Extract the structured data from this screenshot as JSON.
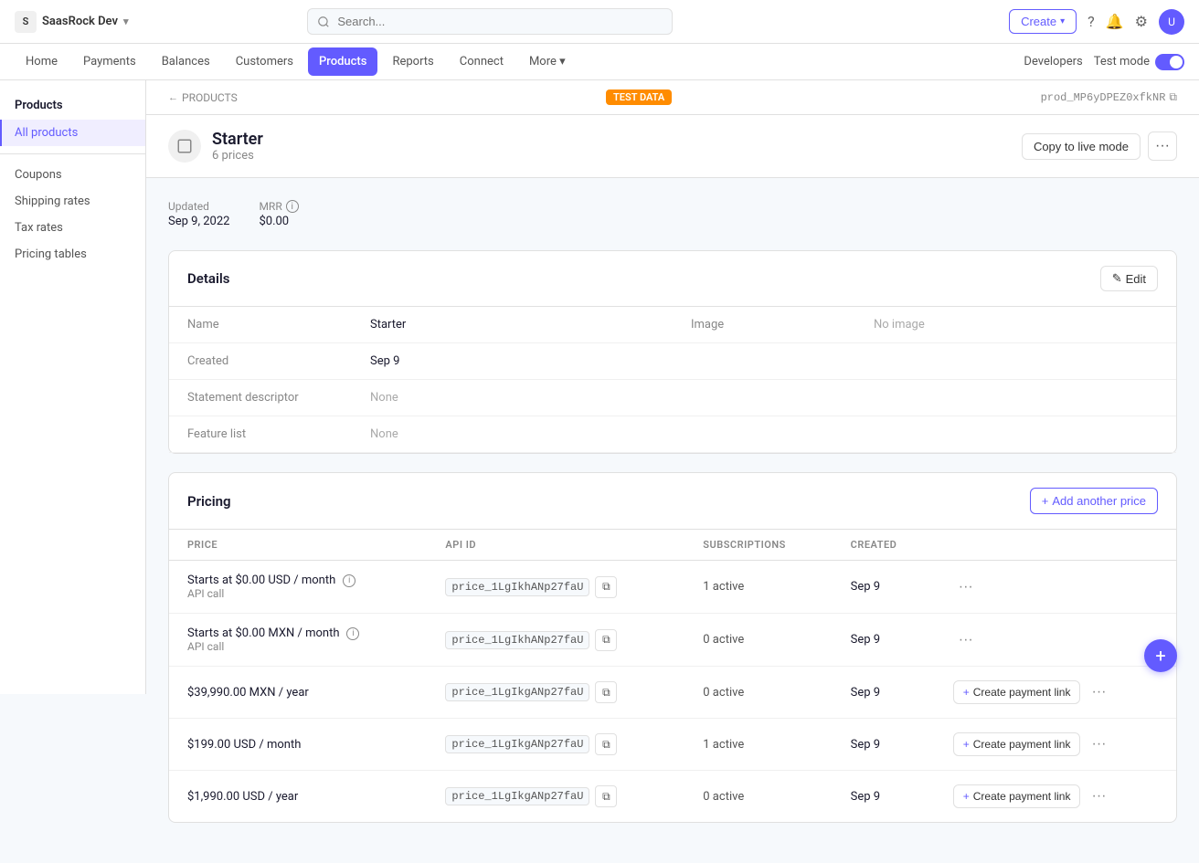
{
  "app": {
    "company": "SaasRock Dev",
    "logo_char": "S"
  },
  "topnav": {
    "create_btn": "Create",
    "help": "Help",
    "search_placeholder": "Search..."
  },
  "secnav": {
    "items": [
      {
        "label": "Home",
        "active": false
      },
      {
        "label": "Payments",
        "active": false
      },
      {
        "label": "Balances",
        "active": false
      },
      {
        "label": "Customers",
        "active": false
      },
      {
        "label": "Products",
        "active": true
      },
      {
        "label": "Reports",
        "active": false
      },
      {
        "label": "Connect",
        "active": false
      },
      {
        "label": "More",
        "active": false
      }
    ],
    "developers": "Developers",
    "test_mode": "Test mode"
  },
  "sidebar": {
    "header": "Products",
    "items": [
      {
        "label": "All products",
        "active": true
      },
      {
        "label": "Coupons",
        "active": false
      },
      {
        "label": "Shipping rates",
        "active": false
      },
      {
        "label": "Tax rates",
        "active": false
      },
      {
        "label": "Pricing tables",
        "active": false
      }
    ]
  },
  "breadcrumb": {
    "back_label": "PRODUCTS",
    "test_badge": "TEST DATA",
    "product_id": "prod_MP6yDPEZ0xfkNR"
  },
  "product": {
    "name": "Starter",
    "prices_count": "6 prices",
    "copy_btn": "Copy to live mode"
  },
  "metadata": {
    "updated_label": "Updated",
    "updated_value": "Sep 9, 2022",
    "mrr_label": "MRR",
    "mrr_value": "$0.00"
  },
  "details": {
    "section_title": "Details",
    "edit_btn": "Edit",
    "fields": [
      {
        "label": "Name",
        "value": "Starter",
        "muted": false
      },
      {
        "label": "Created",
        "value": "Sep 9",
        "muted": false
      },
      {
        "label": "Statement descriptor",
        "value": "None",
        "muted": true
      },
      {
        "label": "Feature list",
        "value": "None",
        "muted": true
      }
    ],
    "image_label": "Image",
    "image_value": "No image"
  },
  "pricing": {
    "section_title": "Pricing",
    "add_price_btn": "Add another price",
    "columns": [
      "PRICE",
      "API ID",
      "SUBSCRIPTIONS",
      "CREATED"
    ],
    "rows": [
      {
        "price": "Starts at $0.00 USD / month",
        "sub_label": "API call",
        "has_info": true,
        "api_id": "price_1LgIkhANp27faU",
        "subscriptions": "1 active",
        "created": "Sep 9",
        "create_link": false
      },
      {
        "price": "Starts at $0.00 MXN / month",
        "sub_label": "API call",
        "has_info": true,
        "api_id": "price_1LgIkhANp27faU",
        "subscriptions": "0 active",
        "created": "Sep 9",
        "create_link": false
      },
      {
        "price": "$39,990.00 MXN / year",
        "sub_label": "",
        "has_info": false,
        "api_id": "price_1LgIkgANp27faU",
        "subscriptions": "0 active",
        "created": "Sep 9",
        "create_link": true,
        "create_link_label": "Create payment link"
      },
      {
        "price": "$199.00 USD / month",
        "sub_label": "",
        "has_info": false,
        "api_id": "price_1LgIkgANp27faU",
        "subscriptions": "1 active",
        "created": "Sep 9",
        "create_link": true,
        "create_link_label": "Create payment link"
      },
      {
        "price": "$1,990.00 USD / year",
        "sub_label": "",
        "has_info": false,
        "api_id": "price_1LgIkgANp27faU",
        "subscriptions": "0 active",
        "created": "Sep 9",
        "create_link": true,
        "create_link_label": "Create payment link"
      }
    ]
  }
}
